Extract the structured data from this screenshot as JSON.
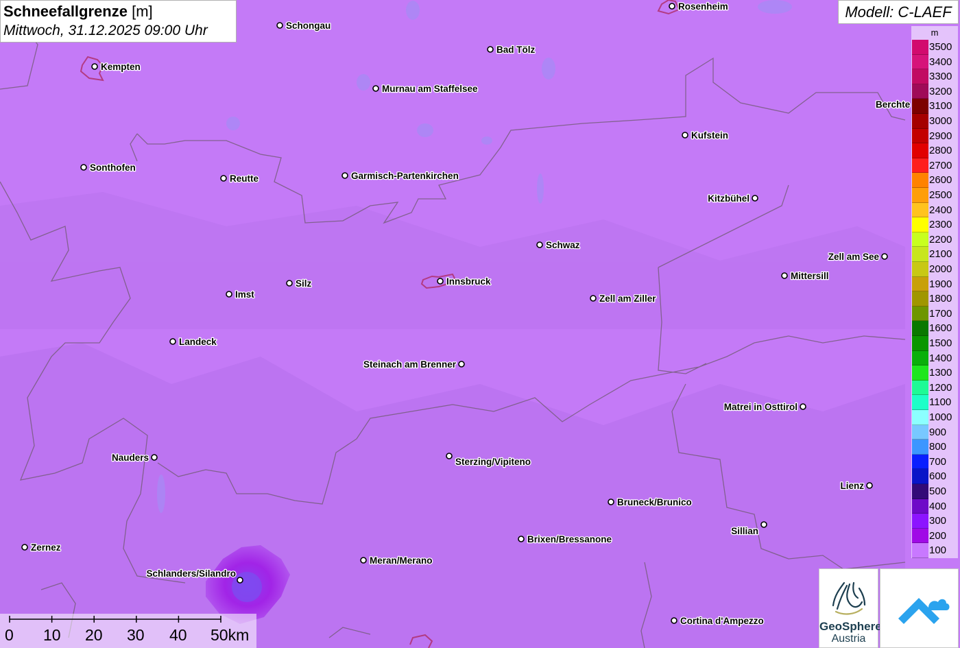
{
  "title": {
    "parameter": "Schneefallgrenze",
    "unit": "[m]",
    "datetime": "Mittwoch, 31.12.2025 09:00 Uhr"
  },
  "model": "Modell: C-LAEF",
  "legend": {
    "unit": "m",
    "entries": [
      {
        "label": "3500",
        "color": "#d20a6e"
      },
      {
        "label": "3400",
        "color": "#d6137a"
      },
      {
        "label": "3300",
        "color": "#c10a62"
      },
      {
        "label": "3200",
        "color": "#9f0a58"
      },
      {
        "label": "3100",
        "color": "#7d0000"
      },
      {
        "label": "3000",
        "color": "#a50000"
      },
      {
        "label": "2900",
        "color": "#c30000"
      },
      {
        "label": "2800",
        "color": "#e10000"
      },
      {
        "label": "2700",
        "color": "#ff1e1e"
      },
      {
        "label": "2600",
        "color": "#ff8200"
      },
      {
        "label": "2500",
        "color": "#ff9e0a"
      },
      {
        "label": "2400",
        "color": "#ffc31e"
      },
      {
        "label": "2300",
        "color": "#ffff00"
      },
      {
        "label": "2200",
        "color": "#c8ff1e"
      },
      {
        "label": "2100",
        "color": "#c8e61e"
      },
      {
        "label": "2000",
        "color": "#c8c814"
      },
      {
        "label": "1900",
        "color": "#c8a00a"
      },
      {
        "label": "1800",
        "color": "#a09600"
      },
      {
        "label": "1700",
        "color": "#6e9600"
      },
      {
        "label": "1600",
        "color": "#0a7800"
      },
      {
        "label": "1500",
        "color": "#0a9600"
      },
      {
        "label": "1400",
        "color": "#0aaf0a"
      },
      {
        "label": "1300",
        "color": "#1ee61e"
      },
      {
        "label": "1200",
        "color": "#1efa96"
      },
      {
        "label": "1100",
        "color": "#1effc8"
      },
      {
        "label": "1000",
        "color": "#8cffff"
      },
      {
        "label": "900",
        "color": "#78c8ff"
      },
      {
        "label": "800",
        "color": "#3c96ff"
      },
      {
        "label": "700",
        "color": "#0a1eff"
      },
      {
        "label": "600",
        "color": "#0a14c8"
      },
      {
        "label": "500",
        "color": "#320a78"
      },
      {
        "label": "400",
        "color": "#6e0ac8"
      },
      {
        "label": "300",
        "color": "#8c14ff"
      },
      {
        "label": "200",
        "color": "#a00ae6"
      },
      {
        "label": "100",
        "color": "#c878ff"
      }
    ]
  },
  "scale_bar": {
    "labels": [
      "0",
      "10",
      "20",
      "30",
      "40",
      "50km"
    ]
  },
  "cities": [
    {
      "name": "Rosenheim"
    },
    {
      "name": "Schongau"
    },
    {
      "name": "Kempten"
    },
    {
      "name": "Bad Tölz"
    },
    {
      "name": "Murnau am Staffelsee"
    },
    {
      "name": "Berchte"
    },
    {
      "name": "Kufstein"
    },
    {
      "name": "Sonthofen"
    },
    {
      "name": "Reutte"
    },
    {
      "name": "Garmisch-Partenkirchen"
    },
    {
      "name": "Kitzbühel"
    },
    {
      "name": "Schwaz"
    },
    {
      "name": "Zell am See"
    },
    {
      "name": "Mittersill"
    },
    {
      "name": "Innsbruck"
    },
    {
      "name": "Silz"
    },
    {
      "name": "Imst"
    },
    {
      "name": "Zell am Ziller"
    },
    {
      "name": "Landeck"
    },
    {
      "name": "Steinach am Brenner"
    },
    {
      "name": "Matrei in Osttirol"
    },
    {
      "name": "Nauders"
    },
    {
      "name": "Sterzing/Vipiteno"
    },
    {
      "name": "Lienz"
    },
    {
      "name": "Bruneck/Brunico"
    },
    {
      "name": "Sillian"
    },
    {
      "name": "Brixen/Bressanone"
    },
    {
      "name": "Zernez"
    },
    {
      "name": "Meran/Merano"
    },
    {
      "name": "Schlanders/Silandro"
    },
    {
      "name": "Cortina d'Ampezzo"
    }
  ],
  "logos": {
    "geosphere_line1": "GeoSphere",
    "geosphere_line2": "Austria"
  }
}
